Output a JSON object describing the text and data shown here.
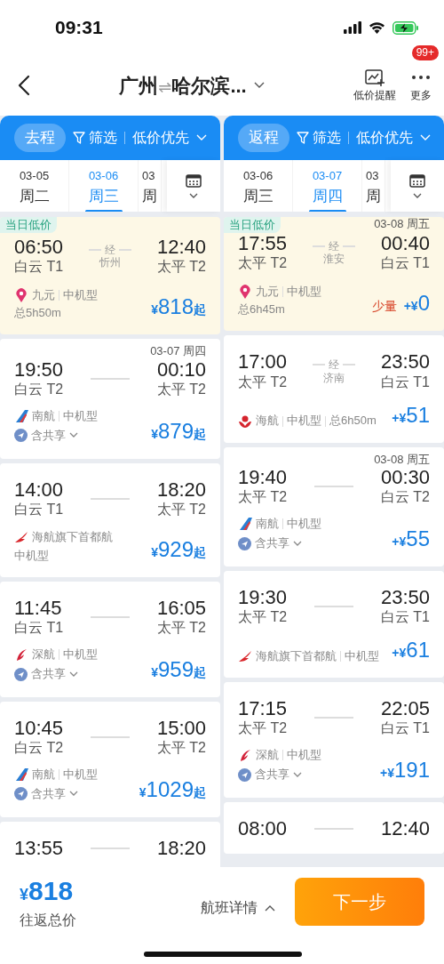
{
  "status_bar": {
    "time": "09:31"
  },
  "nav": {
    "title_from": "广州",
    "title_arrow": "⇌",
    "title_to": "哈尔滨...",
    "actions": [
      {
        "kind": "alert",
        "label": "低价提醒"
      },
      {
        "kind": "more",
        "label": "更多",
        "badge": "99+"
      }
    ]
  },
  "columns": [
    {
      "leg": "去程",
      "filter": "筛选",
      "sort": "低价优先",
      "dates": [
        {
          "date": "03-05",
          "weekday": "周二",
          "selected": false
        },
        {
          "date": "03-06",
          "weekday": "周三",
          "selected": true
        },
        {
          "date": "03",
          "weekday": "周",
          "selected": false
        }
      ],
      "flights": [
        {
          "highlighted": true,
          "badge": "当日低价",
          "dep_time": "06:50",
          "dep_airport": "白云 T1",
          "arr_time": "12:40",
          "arr_airport": "太平 T2",
          "via": {
            "label": "经",
            "city": "忻州"
          },
          "logo": {
            "kind": "pin"
          },
          "airline": [
            "九元",
            "中机型"
          ],
          "extra": "总5h50m",
          "price": {
            "prefix": "¥",
            "amount": "818",
            "suffix": "起"
          }
        },
        {
          "highlighted": false,
          "arr_date": "03-07 周四",
          "dep_time": "19:50",
          "dep_airport": "白云 T2",
          "arr_time": "00:10",
          "arr_airport": "太平 T2",
          "logo": {
            "kind": "tail"
          },
          "airline": [
            "南航",
            "中机型"
          ],
          "share": "含共享",
          "price": {
            "prefix": "¥",
            "amount": "879",
            "suffix": "起"
          }
        },
        {
          "highlighted": false,
          "dep_time": "14:00",
          "dep_airport": "白云 T1",
          "arr_time": "18:20",
          "arr_airport": "太平 T2",
          "logo": {
            "kind": "bird"
          },
          "airline": [
            "海航旗下首都航"
          ],
          "extra": "中机型",
          "price": {
            "prefix": "¥",
            "amount": "929",
            "suffix": "起"
          }
        },
        {
          "highlighted": false,
          "dep_time": "11:45",
          "dep_airport": "白云 T1",
          "arr_time": "16:05",
          "arr_airport": "太平 T2",
          "logo": {
            "kind": "swoosh"
          },
          "airline": [
            "深航",
            "中机型"
          ],
          "share": "含共享",
          "price": {
            "prefix": "¥",
            "amount": "959",
            "suffix": "起"
          }
        },
        {
          "highlighted": false,
          "dep_time": "10:45",
          "dep_airport": "白云 T2",
          "arr_time": "15:00",
          "arr_airport": "太平 T2",
          "logo": {
            "kind": "tail"
          },
          "airline": [
            "南航",
            "中机型"
          ],
          "share": "含共享",
          "price": {
            "prefix": "¥",
            "amount": "1029",
            "suffix": "起"
          }
        },
        {
          "highlighted": false,
          "dep_time": "13:55",
          "arr_time": "18:20"
        }
      ]
    },
    {
      "leg": "返程",
      "filter": "筛选",
      "sort": "低价优先",
      "dates": [
        {
          "date": "03-06",
          "weekday": "周三",
          "selected": false
        },
        {
          "date": "03-07",
          "weekday": "周四",
          "selected": true
        },
        {
          "date": "03",
          "weekday": "周",
          "selected": false
        }
      ],
      "flights": [
        {
          "highlighted": true,
          "badge": "当日低价",
          "arr_date": "03-08 周五",
          "dep_time": "17:55",
          "dep_airport": "太平 T2",
          "arr_time": "00:40",
          "arr_airport": "白云 T1",
          "via": {
            "label": "经",
            "city": "淮安"
          },
          "logo": {
            "kind": "pin"
          },
          "airline": [
            "九元",
            "中机型"
          ],
          "extra": "总6h45m",
          "stock": "少量",
          "price": {
            "prefix": "+¥",
            "amount": "0"
          }
        },
        {
          "highlighted": false,
          "dep_time": "17:00",
          "dep_airport": "太平 T2",
          "arr_time": "23:50",
          "arr_airport": "白云 T1",
          "via": {
            "label": "经",
            "city": "济南"
          },
          "logo": {
            "kind": "emblem"
          },
          "airline": [
            "海航",
            "中机型",
            "总6h50m"
          ],
          "price": {
            "prefix": "+¥",
            "amount": "51"
          }
        },
        {
          "highlighted": false,
          "arr_date": "03-08 周五",
          "dep_time": "19:40",
          "dep_airport": "太平 T2",
          "arr_time": "00:30",
          "arr_airport": "白云 T2",
          "logo": {
            "kind": "tail"
          },
          "airline": [
            "南航",
            "中机型"
          ],
          "share": "含共享",
          "price": {
            "prefix": "+¥",
            "amount": "55"
          }
        },
        {
          "highlighted": false,
          "dep_time": "19:30",
          "dep_airport": "太平 T2",
          "arr_time": "23:50",
          "arr_airport": "白云 T1",
          "logo": {
            "kind": "bird"
          },
          "airline": [
            "海航旗下首都航",
            "中机型"
          ],
          "price": {
            "prefix": "+¥",
            "amount": "61"
          }
        },
        {
          "highlighted": false,
          "dep_time": "17:15",
          "dep_airport": "太平 T2",
          "arr_time": "22:05",
          "arr_airport": "白云 T1",
          "logo": {
            "kind": "swoosh"
          },
          "airline": [
            "深航",
            "中机型"
          ],
          "share": "含共享",
          "price": {
            "prefix": "+¥",
            "amount": "191"
          }
        },
        {
          "highlighted": false,
          "dep_time": "08:00",
          "arr_time": "12:40"
        }
      ]
    }
  ],
  "footer": {
    "total": {
      "prefix": "¥",
      "amount": "818"
    },
    "total_label": "往返总价",
    "details": "航班详情",
    "next": "下一步"
  }
}
